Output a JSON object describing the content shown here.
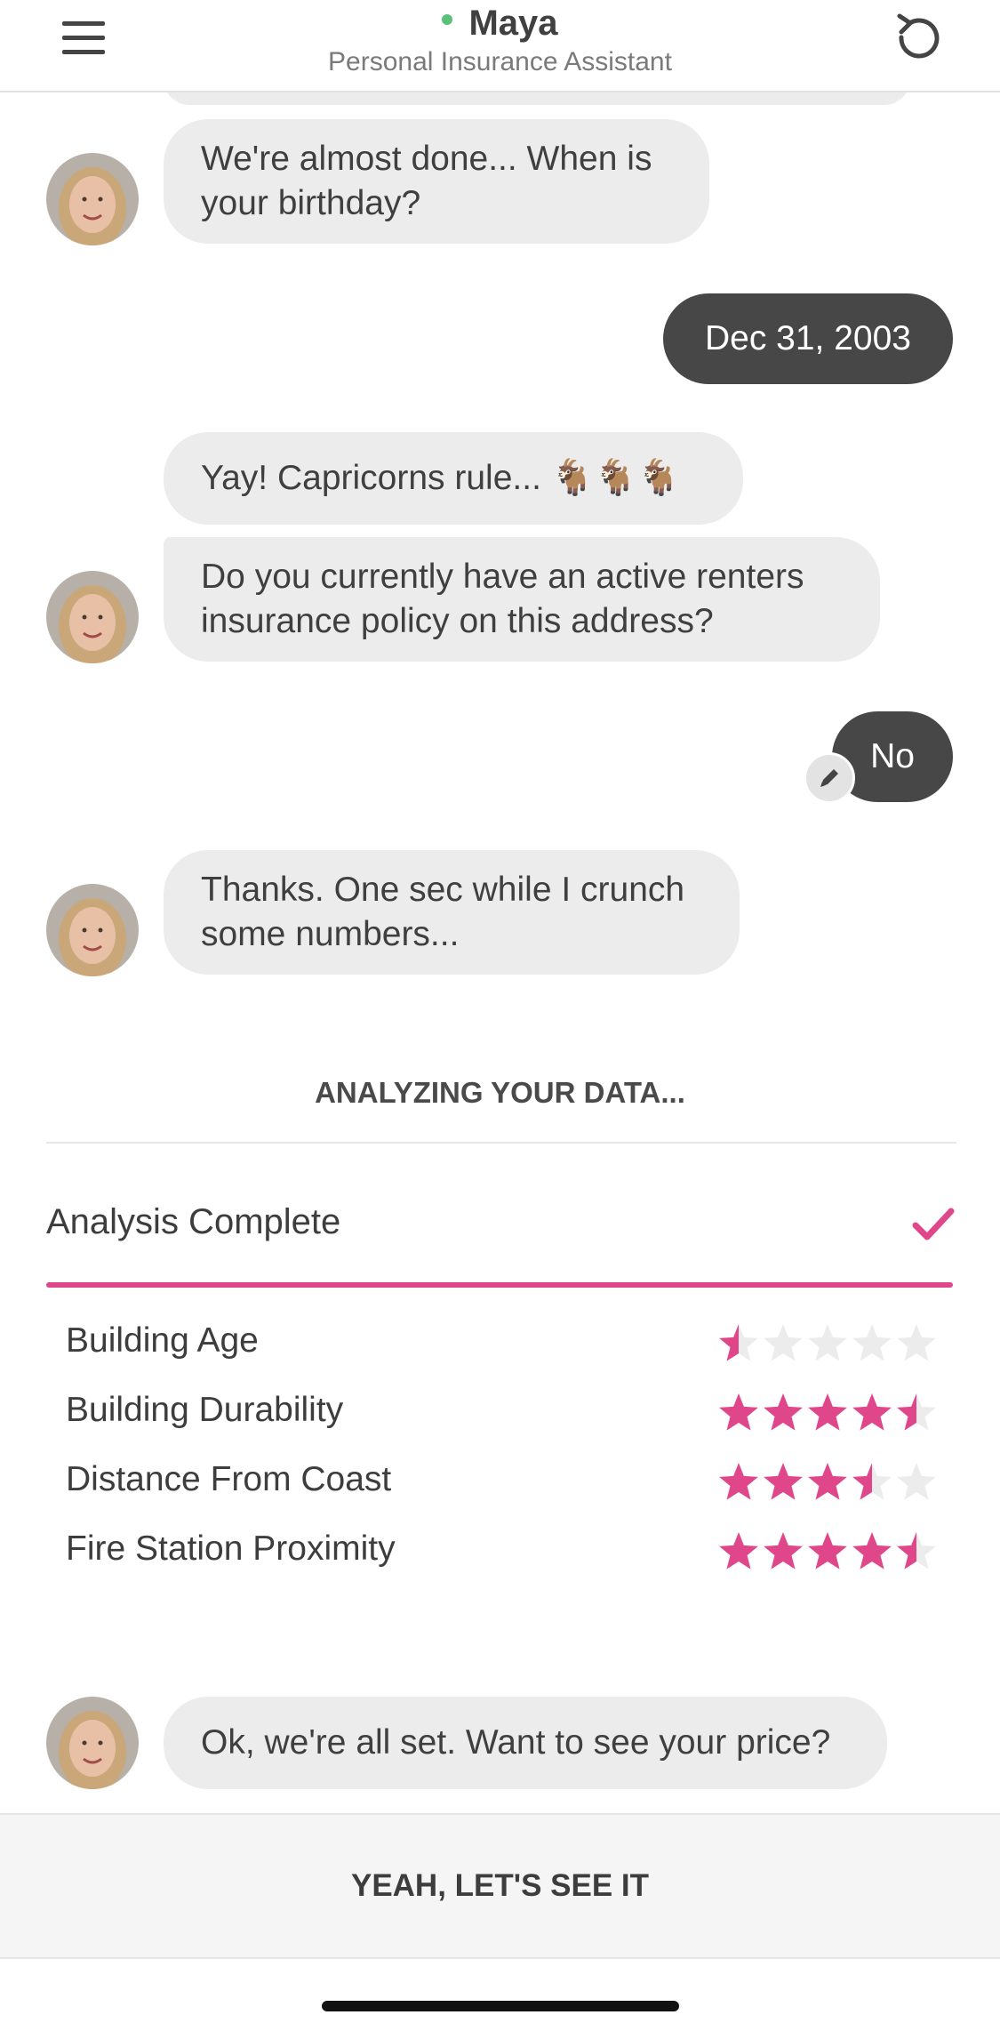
{
  "header": {
    "assistant_name": "Maya",
    "assistant_role": "Personal Insurance Assistant",
    "status_color": "#5ac17a"
  },
  "chat": {
    "messages": [
      {
        "sender": "assistant",
        "text": "We're almost done... When is your birthday?"
      },
      {
        "sender": "user",
        "text": "Dec 31, 2003"
      },
      {
        "sender": "assistant",
        "text": "Yay! Capricorns rule... 🐐🐐🐐"
      },
      {
        "sender": "assistant",
        "text": "Do you currently have an active renters insurance policy on this address?"
      },
      {
        "sender": "user",
        "text": "No"
      },
      {
        "sender": "assistant",
        "text": "Thanks. One sec while I crunch some numbers..."
      },
      {
        "sender": "assistant",
        "text": "Ok, we're all set. Want to see your price?"
      }
    ]
  },
  "analysis": {
    "title": "ANALYZING YOUR DATA...",
    "status": "Analysis Complete",
    "progress": 1.0,
    "accent_color": "#e0478a",
    "ratings": [
      {
        "label": "Building Age",
        "stars": 0.5
      },
      {
        "label": "Building Durability",
        "stars": 4.5
      },
      {
        "label": "Distance From Coast",
        "stars": 3.5
      },
      {
        "label": "Fire Station Proximity",
        "stars": 4.5
      }
    ],
    "max_stars": 5
  },
  "footer": {
    "cta_label": "YEAH, LET'S SEE IT"
  }
}
